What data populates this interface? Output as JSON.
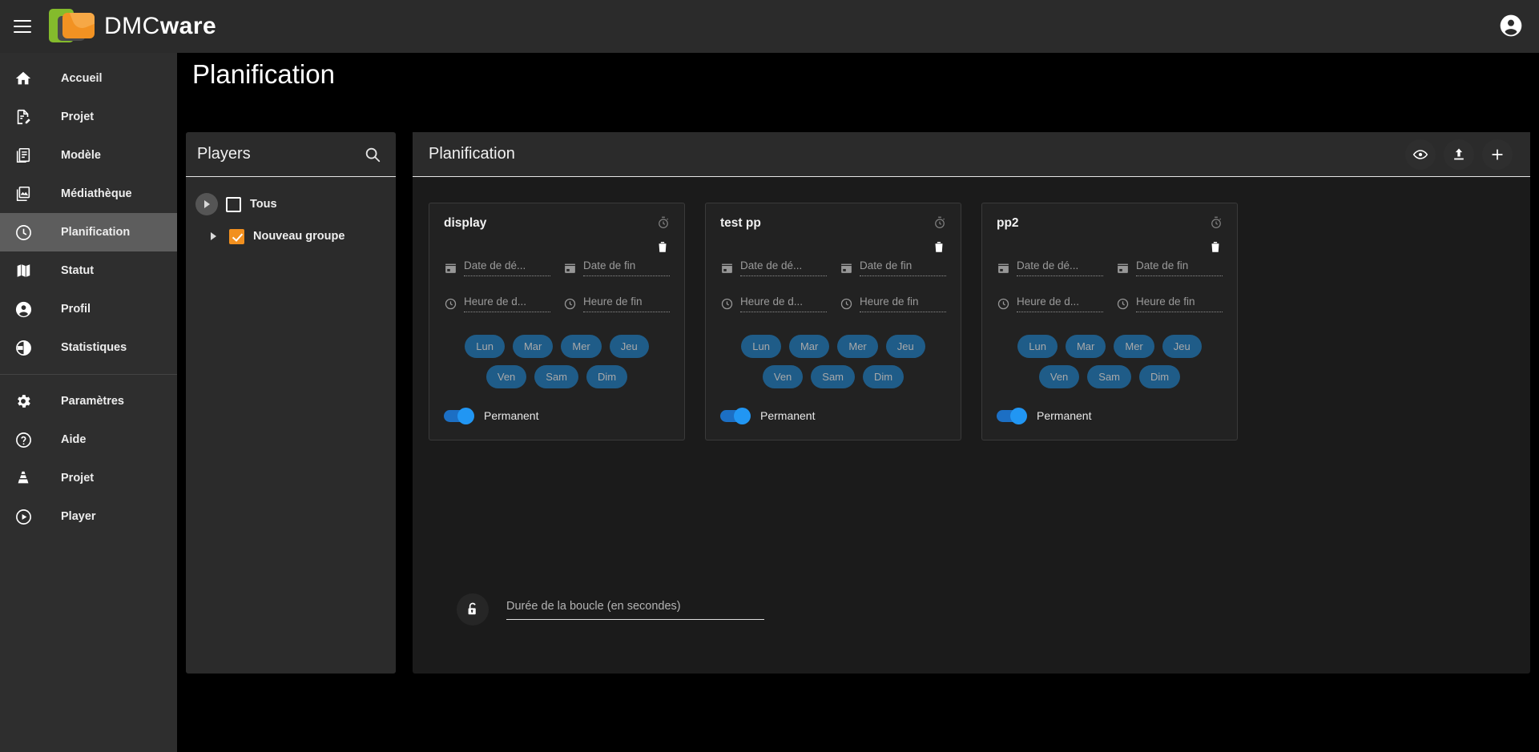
{
  "app": {
    "logo_prefix": "DMC",
    "logo_suffix": "ware",
    "menu_icon": "hamburger-menu-icon",
    "account_icon": "account-circle-icon"
  },
  "page": {
    "title": "Planification"
  },
  "sidebar": {
    "items": [
      {
        "label": "Accueil",
        "icon": "home-icon",
        "active": false
      },
      {
        "label": "Projet",
        "icon": "document-edit-icon",
        "active": false
      },
      {
        "label": "Modèle",
        "icon": "library-books-icon",
        "active": false
      },
      {
        "label": "Médiathèque",
        "icon": "photo-library-icon",
        "active": false
      },
      {
        "label": "Planification",
        "icon": "clock-icon",
        "active": true
      },
      {
        "label": "Statut",
        "icon": "map-icon",
        "active": false
      },
      {
        "label": "Profil",
        "icon": "account-circle-icon",
        "active": false
      },
      {
        "label": "Statistiques",
        "icon": "pie-chart-icon",
        "active": false
      },
      {
        "label": "Paramètres",
        "icon": "gear-icon",
        "active": false
      },
      {
        "label": "Aide",
        "icon": "help-circle-icon",
        "active": false
      },
      {
        "label": "Projet",
        "icon": "vlc-cone-icon",
        "active": false
      },
      {
        "label": "Player",
        "icon": "play-circle-icon",
        "active": false
      }
    ],
    "divider_after_index": 7
  },
  "players_panel": {
    "title": "Players",
    "search_icon": "search-icon",
    "tree": [
      {
        "label": "Tous",
        "checked": false,
        "caret": "circle"
      },
      {
        "label": "Nouveau groupe",
        "checked": true,
        "caret": "plain"
      }
    ]
  },
  "plan_panel": {
    "title": "Planification",
    "actions": [
      {
        "name": "preview-button",
        "icon": "eye-icon"
      },
      {
        "name": "publish-button",
        "icon": "upload-icon"
      },
      {
        "name": "add-button",
        "icon": "plus-icon"
      }
    ],
    "cards": [
      {
        "title": "display",
        "timer_icon": "stopwatch-icon",
        "delete_icon": "trash-icon",
        "start_date_placeholder": "Date de dé...",
        "end_date_placeholder": "Date de fin",
        "start_time_placeholder": "Heure de d...",
        "end_time_placeholder": "Heure de fin",
        "days": [
          "Lun",
          "Mar",
          "Mer",
          "Jeu",
          "Ven",
          "Sam",
          "Dim"
        ],
        "permanent_label": "Permanent",
        "permanent_on": true
      },
      {
        "title": "test pp",
        "timer_icon": "stopwatch-icon",
        "delete_icon": "trash-icon",
        "start_date_placeholder": "Date de dé...",
        "end_date_placeholder": "Date de fin",
        "start_time_placeholder": "Heure de d...",
        "end_time_placeholder": "Heure de fin",
        "days": [
          "Lun",
          "Mar",
          "Mer",
          "Jeu",
          "Ven",
          "Sam",
          "Dim"
        ],
        "permanent_label": "Permanent",
        "permanent_on": true
      },
      {
        "title": "pp2",
        "timer_icon": "stopwatch-icon",
        "delete_icon": "trash-icon",
        "start_date_placeholder": "Date de dé...",
        "end_date_placeholder": "Date de fin",
        "start_time_placeholder": "Heure de d...",
        "end_time_placeholder": "Heure de fin",
        "days": [
          "Lun",
          "Mar",
          "Mer",
          "Jeu",
          "Ven",
          "Sam",
          "Dim"
        ],
        "permanent_label": "Permanent",
        "permanent_on": true
      }
    ],
    "loop": {
      "lock_icon": "lock-open-icon",
      "placeholder": "Durée de la boucle (en secondes)"
    }
  },
  "colors": {
    "accent_orange": "#f2901f",
    "accent_blue": "#2196f3",
    "chip_blue": "#1f5c88",
    "sidebar_bg": "#2e2e2e",
    "panel_bg": "#2b2b2b",
    "logo_green": "#84bb2c",
    "logo_orange": "#f29222"
  }
}
